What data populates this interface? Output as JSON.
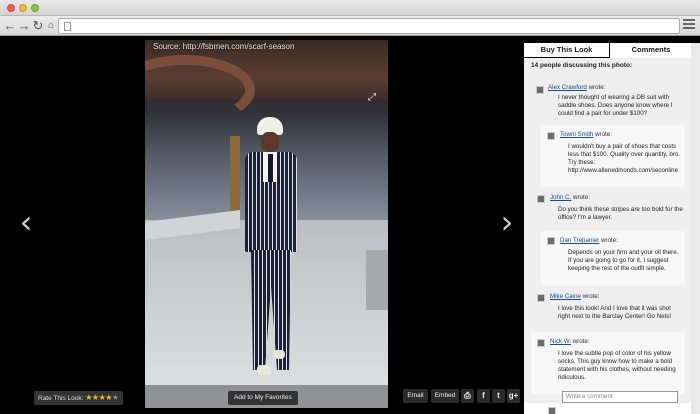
{
  "browser": {
    "back_icon": "back-arrow-icon",
    "forward_icon": "forward-arrow-icon",
    "reload_icon": "reload-icon",
    "home_icon": "home-icon",
    "menu_icon": "hamburger-menu-icon",
    "url": ""
  },
  "viewer": {
    "source_text": "Source: http://fsbmen.com/scarf-season",
    "prev_arrow": "‹",
    "next_arrow": "›",
    "expand_glyph": "⤢",
    "rate_label": "Rate This Look:",
    "rating": 4,
    "rating_max": 5,
    "favorites_label": "Add to My Favorites",
    "share": {
      "email": "Email",
      "embed": "Embed",
      "print_glyph": "⎙",
      "facebook_glyph": "f",
      "twitter_glyph": "t",
      "gplus_glyph": "g+"
    }
  },
  "panel": {
    "tab_buy": "Buy This Look",
    "tab_comments": "Comments",
    "count_text": "14 people discussing this photo:",
    "reply_placeholder": "Write a comment",
    "comments": [
      {
        "name": "Alex Crawford",
        "suffix": " wrote:",
        "text": "I never thought of wearing a DB suit with saddle shoes. Does anyone know where I could find a pair for under $100?"
      },
      {
        "name": "Towni Smith",
        "suffix": " wrote:",
        "text": "I wouldn't buy a pair of shoes that costs less that $100. Quality over quantity, bro. Try these: http://www.allenedmonds.com/seconline"
      },
      {
        "name": "John C.",
        "suffix": " wrote:",
        "text": "Do you think these stripes are too bold for the office? I'm a lawyer."
      },
      {
        "name": "Dan Trepanier",
        "suffix": " wrote:",
        "text": "Depends on your firm and your oll there. If you are going to go for it, I suggest keeping the rest of the outfit simple."
      },
      {
        "name": "Mike Caine",
        "suffix": " wrote:",
        "text": "I love this look! And I love that it was shot right next to the Barclay Center! Go Nets!"
      },
      {
        "name": "Nick W.",
        "suffix": " wrote:",
        "text": "I love the subtle pop of color of his yellow socks. This guy know how to make a bold statement with his clothes, without needing ridiculous."
      }
    ]
  }
}
